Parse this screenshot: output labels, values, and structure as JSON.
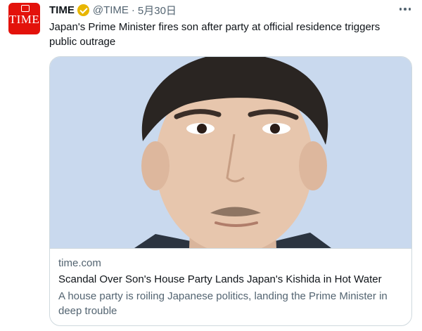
{
  "tweet": {
    "avatar_text": "TIME",
    "author_name": "TIME",
    "author_handle": "@TIME",
    "separator": "·",
    "date": "5月30日",
    "text": "Japan's Prime Minister fires son after party at official residence triggers public outrage"
  },
  "card": {
    "domain": "time.com",
    "title": "Scandal Over Son's House Party Lands Japan's Kishida in Hot Water",
    "description": "A house party is roiling Japanese politics, landing the Prime Minister in deep trouble"
  },
  "colors": {
    "brand": "#e3120b",
    "verified_badge": "#e8b600",
    "secondary_text": "#536471",
    "photo_background": "#c9d9ee"
  },
  "icons": {
    "more": "more-dots-icon",
    "verified": "verified-badge-icon"
  }
}
